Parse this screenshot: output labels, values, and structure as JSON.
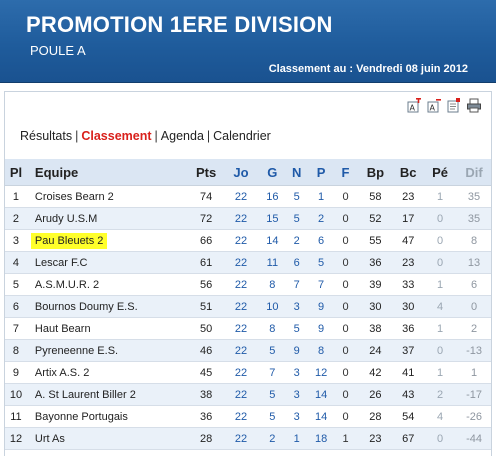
{
  "header": {
    "title": "PROMOTION 1ERE DIVISION",
    "subtitle": "POULE A",
    "date_label": "Classement au : Vendredi 08 juin 2012"
  },
  "tools": [
    {
      "name": "font-increase-icon"
    },
    {
      "name": "font-decrease-icon"
    },
    {
      "name": "edit-icon"
    },
    {
      "name": "print-icon"
    }
  ],
  "nav": {
    "items": [
      "Résultats",
      "Classement",
      "Agenda",
      "Calendrier"
    ],
    "active": "Classement",
    "separator": "|"
  },
  "table": {
    "headers": [
      "Pl",
      "Equipe",
      "Pts",
      "Jo",
      "G",
      "N",
      "P",
      "F",
      "Bp",
      "Bc",
      "Pé",
      "Dif"
    ],
    "highlighted_team": "Pau Bleuets 2",
    "highlight_color": "#ffff2a",
    "rows": [
      {
        "pl": "1",
        "team": "Croises Bearn 2",
        "pts": "74",
        "jo": "22",
        "g": "16",
        "n": "5",
        "p": "1",
        "f": "0",
        "bp": "58",
        "bc": "23",
        "pe": "1",
        "dif": "35"
      },
      {
        "pl": "2",
        "team": "Arudy U.S.M",
        "pts": "72",
        "jo": "22",
        "g": "15",
        "n": "5",
        "p": "2",
        "f": "0",
        "bp": "52",
        "bc": "17",
        "pe": "0",
        "dif": "35"
      },
      {
        "pl": "3",
        "team": "Pau Bleuets 2",
        "pts": "66",
        "jo": "22",
        "g": "14",
        "n": "2",
        "p": "6",
        "f": "0",
        "bp": "55",
        "bc": "47",
        "pe": "0",
        "dif": "8"
      },
      {
        "pl": "4",
        "team": "Lescar F.C",
        "pts": "61",
        "jo": "22",
        "g": "11",
        "n": "6",
        "p": "5",
        "f": "0",
        "bp": "36",
        "bc": "23",
        "pe": "0",
        "dif": "13"
      },
      {
        "pl": "5",
        "team": "A.S.M.U.R. 2",
        "pts": "56",
        "jo": "22",
        "g": "8",
        "n": "7",
        "p": "7",
        "f": "0",
        "bp": "39",
        "bc": "33",
        "pe": "1",
        "dif": "6"
      },
      {
        "pl": "6",
        "team": "Bournos Doumy E.S.",
        "pts": "51",
        "jo": "22",
        "g": "10",
        "n": "3",
        "p": "9",
        "f": "0",
        "bp": "30",
        "bc": "30",
        "pe": "4",
        "dif": "0"
      },
      {
        "pl": "7",
        "team": "Haut Bearn",
        "pts": "50",
        "jo": "22",
        "g": "8",
        "n": "5",
        "p": "9",
        "f": "0",
        "bp": "38",
        "bc": "36",
        "pe": "1",
        "dif": "2"
      },
      {
        "pl": "8",
        "team": "Pyreneenne E.S.",
        "pts": "46",
        "jo": "22",
        "g": "5",
        "n": "9",
        "p": "8",
        "f": "0",
        "bp": "24",
        "bc": "37",
        "pe": "0",
        "dif": "-13"
      },
      {
        "pl": "9",
        "team": "Artix A.S. 2",
        "pts": "45",
        "jo": "22",
        "g": "7",
        "n": "3",
        "p": "12",
        "f": "0",
        "bp": "42",
        "bc": "41",
        "pe": "1",
        "dif": "1"
      },
      {
        "pl": "10",
        "team": "A. St Laurent Biller 2",
        "pts": "38",
        "jo": "22",
        "g": "5",
        "n": "3",
        "p": "14",
        "f": "0",
        "bp": "26",
        "bc": "43",
        "pe": "2",
        "dif": "-17"
      },
      {
        "pl": "11",
        "team": "Bayonne Portugais",
        "pts": "36",
        "jo": "22",
        "g": "5",
        "n": "3",
        "p": "14",
        "f": "0",
        "bp": "28",
        "bc": "54",
        "pe": "4",
        "dif": "-26"
      },
      {
        "pl": "12",
        "team": "Urt As",
        "pts": "28",
        "jo": "22",
        "g": "2",
        "n": "1",
        "p": "18",
        "f": "1",
        "bp": "23",
        "bc": "67",
        "pe": "0",
        "dif": "-44"
      }
    ]
  }
}
